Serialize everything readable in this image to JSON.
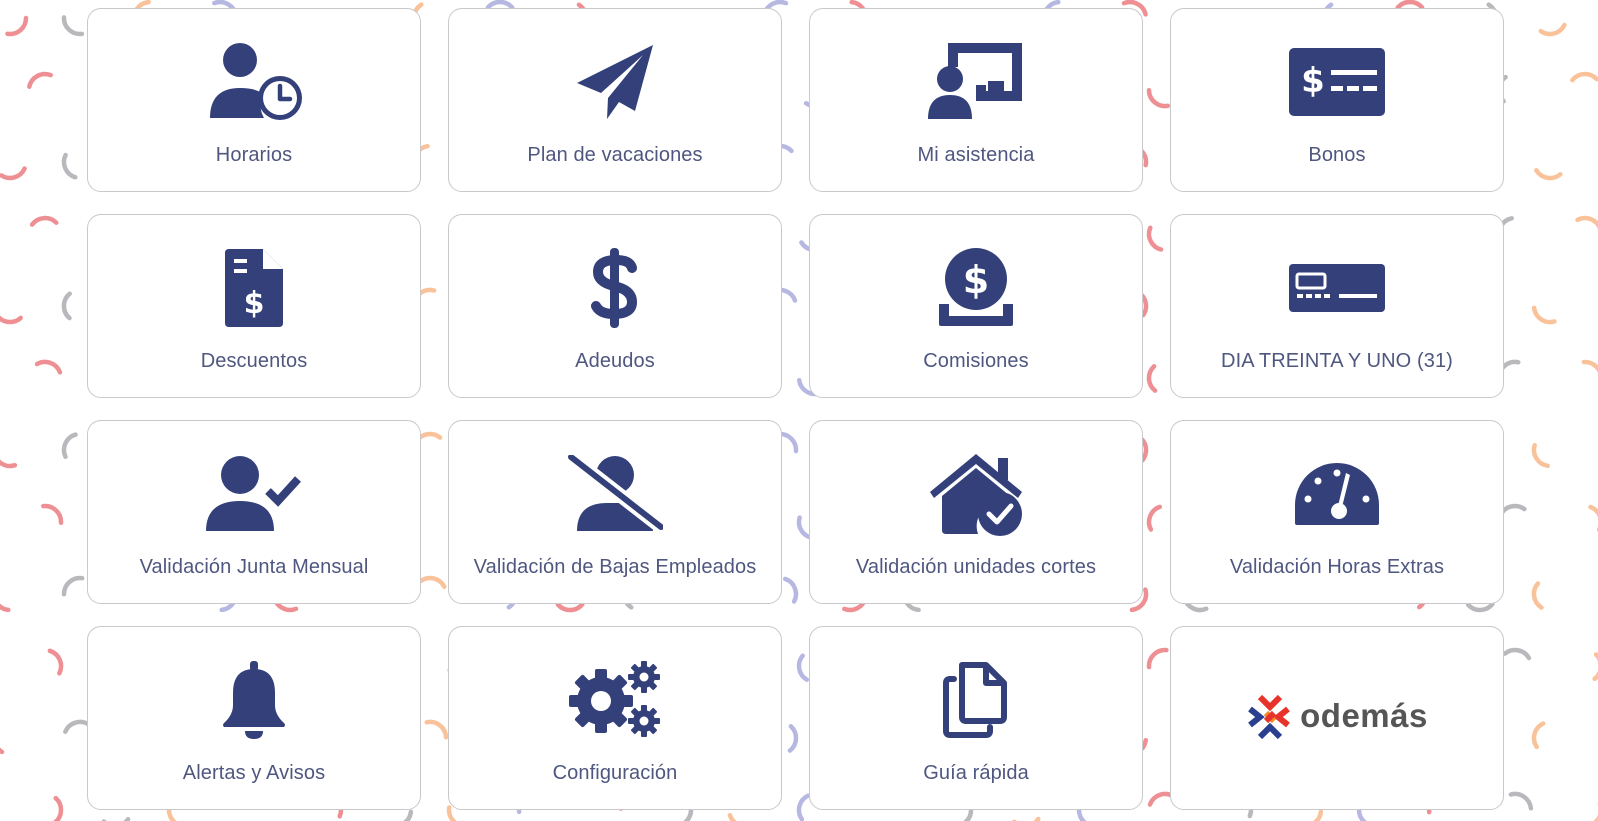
{
  "colors": {
    "icon": "#34407a",
    "label": "#4f5780",
    "tile_border": "#c9c9cc",
    "pattern_red": "#ee8f93",
    "pattern_gray": "#b9b9bd",
    "pattern_orange": "#f9c29a",
    "pattern_purple": "#b6b8e2"
  },
  "tiles": [
    {
      "label": "Horarios",
      "icon": "user-clock-icon"
    },
    {
      "label": "Plan de vacaciones",
      "icon": "paper-plane-icon"
    },
    {
      "label": "Mi asistencia",
      "icon": "chalkboard-user-icon"
    },
    {
      "label": "Bonos",
      "icon": "money-check-icon"
    },
    {
      "label": "Descuentos",
      "icon": "file-invoice-dollar-icon"
    },
    {
      "label": "Adeudos",
      "icon": "dollar-sign-icon"
    },
    {
      "label": "Comisiones",
      "icon": "coin-deposit-icon"
    },
    {
      "label": "DIA TREINTA Y UNO (31)",
      "icon": "credit-card-icon"
    },
    {
      "label": "Validación Junta Mensual",
      "icon": "user-check-icon"
    },
    {
      "label": "Validación de Bajas Empleados",
      "icon": "user-slash-icon"
    },
    {
      "label": "Validación unidades cortes",
      "icon": "house-check-icon"
    },
    {
      "label": "Validación Horas Extras",
      "icon": "gauge-icon"
    },
    {
      "label": "Alertas y Avisos",
      "icon": "bell-icon"
    },
    {
      "label": "Configuración",
      "icon": "gears-icon"
    },
    {
      "label": "Guía rápida",
      "icon": "copy-icon"
    },
    {
      "label": "",
      "icon": "odemas-logo"
    }
  ],
  "logo": {
    "text": "odemás"
  }
}
